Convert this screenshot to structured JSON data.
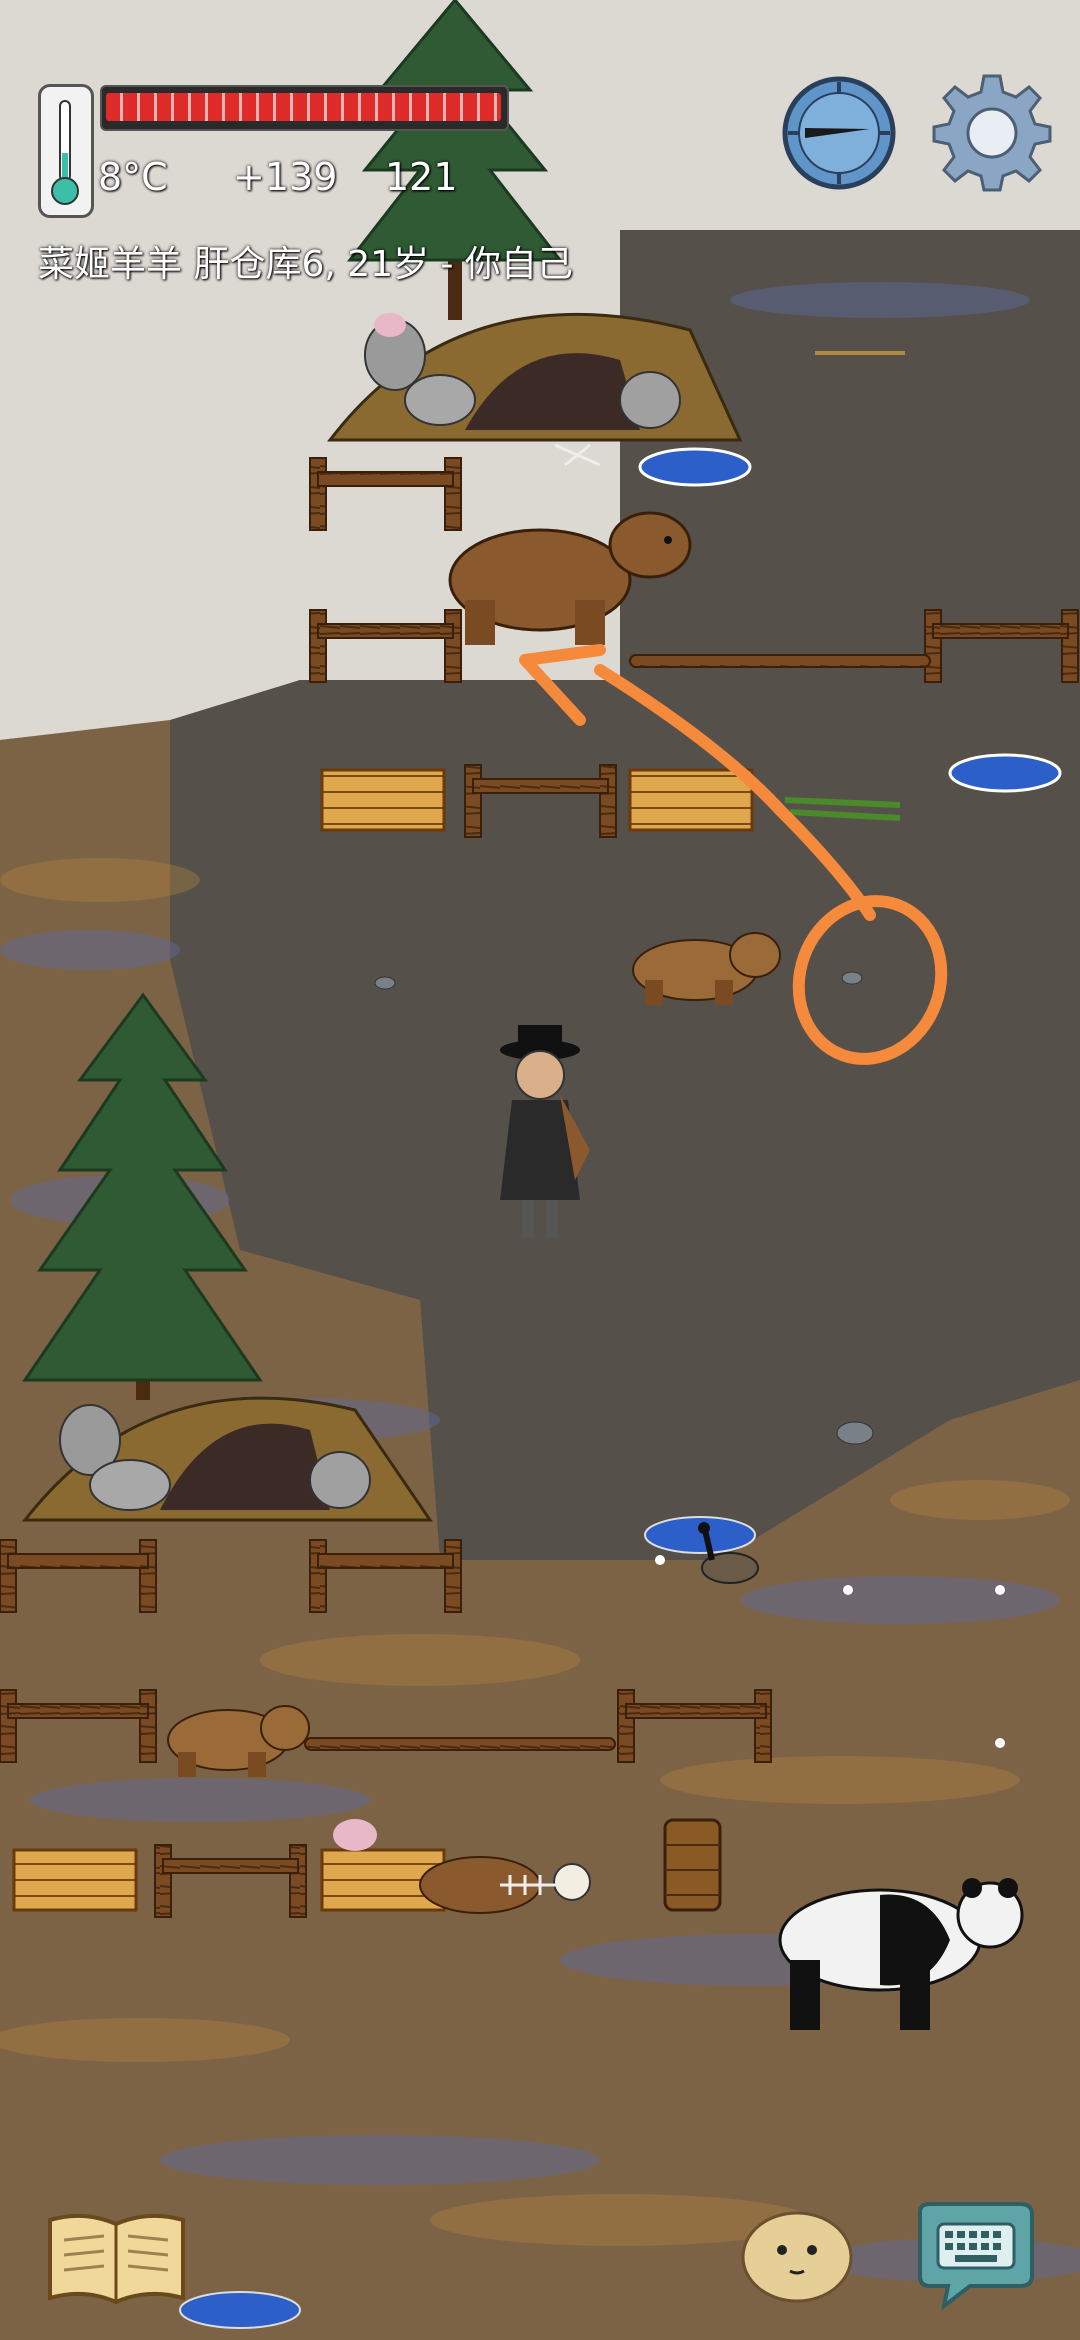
{
  "hud": {
    "temperature": "8°C",
    "food_bonus": "+139",
    "yum_count": "121",
    "status_line": "菜姬羊羊 肝仓库6, 21岁 - 你自己",
    "hunger_bar_fraction": 1.0,
    "temperature_gauge_fraction": 0.35
  },
  "colors": {
    "snow": "#d9d7d2",
    "dirt": "#7a5c38",
    "rock": "#4f4a45",
    "annotation_orange": "#f58a3c",
    "hunger_red": "#e02b2b",
    "gauge_teal": "#3bbfa8"
  },
  "icons": {
    "compass": "compass-icon",
    "settings": "gear-icon",
    "tech_book": "book-icon",
    "emote": "emote-face-icon",
    "keyboard": "keyboard-icon",
    "thermometer": "thermometer-icon"
  }
}
